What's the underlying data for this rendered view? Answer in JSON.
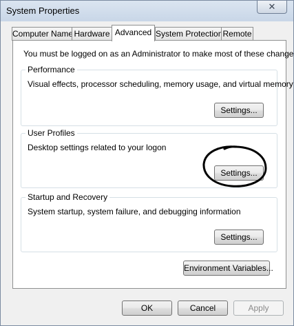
{
  "window": {
    "title": "System Properties",
    "close_glyph": "✕"
  },
  "tabs": [
    {
      "label": "Computer Name",
      "active": false
    },
    {
      "label": "Hardware",
      "active": false
    },
    {
      "label": "Advanced",
      "active": true
    },
    {
      "label": "System Protection",
      "active": false
    },
    {
      "label": "Remote",
      "active": false
    }
  ],
  "admin_note": "You must be logged on as an Administrator to make most of these changes.",
  "groups": {
    "performance": {
      "title": "Performance",
      "description": "Visual effects, processor scheduling, memory usage, and virtual memory",
      "button": "Settings..."
    },
    "user_profiles": {
      "title": "User Profiles",
      "description": "Desktop settings related to your logon",
      "button": "Settings..."
    },
    "startup_recovery": {
      "title": "Startup and Recovery",
      "description": "System startup, system failure, and debugging information",
      "button": "Settings..."
    }
  },
  "env_button": "Environment Variables...",
  "footer": {
    "ok": "OK",
    "cancel": "Cancel",
    "apply": "Apply"
  },
  "icons": {
    "close": "close-icon"
  },
  "annotation": {
    "color": "#000000"
  }
}
